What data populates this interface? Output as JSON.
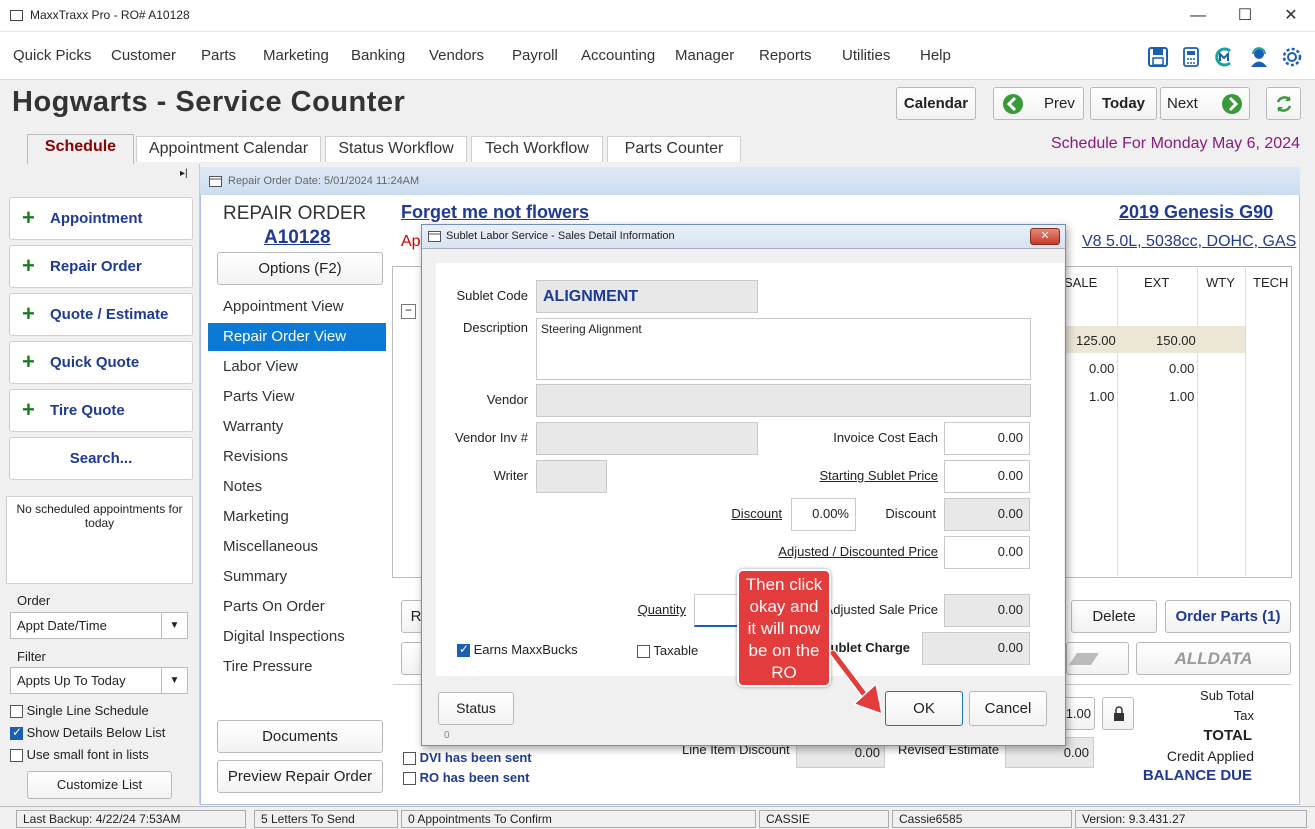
{
  "window": {
    "title": "MaxxTraxx Pro - RO# A10128",
    "minimize": "—",
    "maximize": "☐",
    "close": "✕"
  },
  "menu": [
    "Quick Picks",
    "Customer",
    "Parts",
    "Marketing",
    "Banking",
    "Vendors",
    "Payroll",
    "Accounting",
    "Manager",
    "Reports",
    "Utilities",
    "Help"
  ],
  "toolbar_icons": [
    "save-icon",
    "calculator-icon",
    "maxx-logo-icon",
    "support-person-icon",
    "gear-icon"
  ],
  "header": {
    "title": "Hogwarts - Service Counter",
    "calendar": "Calendar",
    "prev": "Prev",
    "today": "Today",
    "next": "Next",
    "schedule_for": "Schedule For Monday May  6, 2024"
  },
  "tabs": [
    "Schedule",
    "Appointment Calendar",
    "Status Workflow",
    "Tech Workflow",
    "Parts Counter"
  ],
  "left": {
    "buttons": [
      "Appointment",
      "Repair Order",
      "Quote / Estimate",
      "Quick Quote",
      "Tire Quote"
    ],
    "search": "Search...",
    "no_appointments": "No scheduled appointments for today",
    "order_label": "Order",
    "order_value": "Appt Date/Time",
    "filter_label": "Filter",
    "filter_value": "Appts Up To Today",
    "single_line": "Single Line Schedule",
    "show_details": "Show Details Below List",
    "small_font": "Use small font in lists",
    "customize": "Customize List"
  },
  "ro": {
    "window_title": "Repair Order Date:  5/01/2024  11:24AM",
    "heading": "REPAIR ORDER",
    "number": "A10128",
    "options": "Options (F2)",
    "customer": "Forget me not flowers",
    "customer_sub": "Ap",
    "vehicle": "2019 Genesis  G90",
    "engine": "V8 5.0L, 5038cc, DOHC, GAS",
    "nav": [
      "Appointment View",
      "Repair Order View",
      "Labor View",
      "Parts View",
      "Warranty",
      "Revisions",
      "Notes",
      "Marketing",
      "Miscellaneous",
      "Summary",
      "Parts On Order",
      "Digital Inspections",
      "Tire Pressure"
    ],
    "documents": "Documents",
    "preview": "Preview Repair Order",
    "grid_headers": {
      "sale": "SALE",
      "ext": "EXT",
      "wty": "WTY",
      "tech": "TECH"
    },
    "grid_rows": [
      {
        "sale": "125.00",
        "ext": "150.00"
      },
      {
        "sale": "0.00",
        "ext": "0.00"
      },
      {
        "sale": "1.00",
        "ext": "1.00"
      }
    ],
    "delete": "Delete",
    "order_parts": "Order Parts (1)",
    "alldata": "ALLDATA",
    "partial_btn": "R",
    "qty_val": "1.00",
    "line_item_discount": "Line Item Discount",
    "line_item_discount_val": "0.00",
    "revised_estimate": "Revised Estimate",
    "revised_estimate_val": "0.00",
    "dvi_sent": "DVI has been sent",
    "ro_sent": "RO has been sent",
    "totals": [
      "Sub Total",
      "Tax",
      "TOTAL",
      "Credit Applied",
      "BALANCE DUE"
    ]
  },
  "dialog": {
    "title": "Sublet Labor Service - Sales Detail Information",
    "sublet_code_label": "Sublet Code",
    "sublet_code": "ALIGNMENT",
    "description_label": "Description",
    "description": "Steering Alignment",
    "vendor_label": "Vendor",
    "vendor_inv_label": "Vendor Inv #",
    "writer_label": "Writer",
    "invoice_cost_label": "Invoice Cost Each",
    "invoice_cost": "0.00",
    "starting_price_label": "Starting Sublet Price",
    "starting_price": "0.00",
    "discount_label": "Discount",
    "discount_pct": "0.00%",
    "discount_label2": "Discount",
    "discount_amt": "0.00",
    "adjusted_label": "Adjusted / Discounted Price",
    "adjusted": "0.00",
    "quantity_label": "Quantity",
    "adjusted_sale_label": "Adjusted Sale Price",
    "adjusted_sale": "0.00",
    "sublet_charge_label": "Sublet Charge",
    "sublet_charge": "0.00",
    "earns_maxxbucks": "Earns MaxxBucks",
    "taxable": "Taxable",
    "status": "Status",
    "status_num": "0",
    "ok": "OK",
    "cancel": "Cancel"
  },
  "callout": "Then click okay and it will now be on the RO",
  "statusbar": [
    "Last Backup:  4/22/24   7:53AM",
    "5 Letters To Send",
    "0 Appointments To Confirm",
    "CASSIE",
    "Cassie6585",
    "Version:  9.3.431.27"
  ]
}
